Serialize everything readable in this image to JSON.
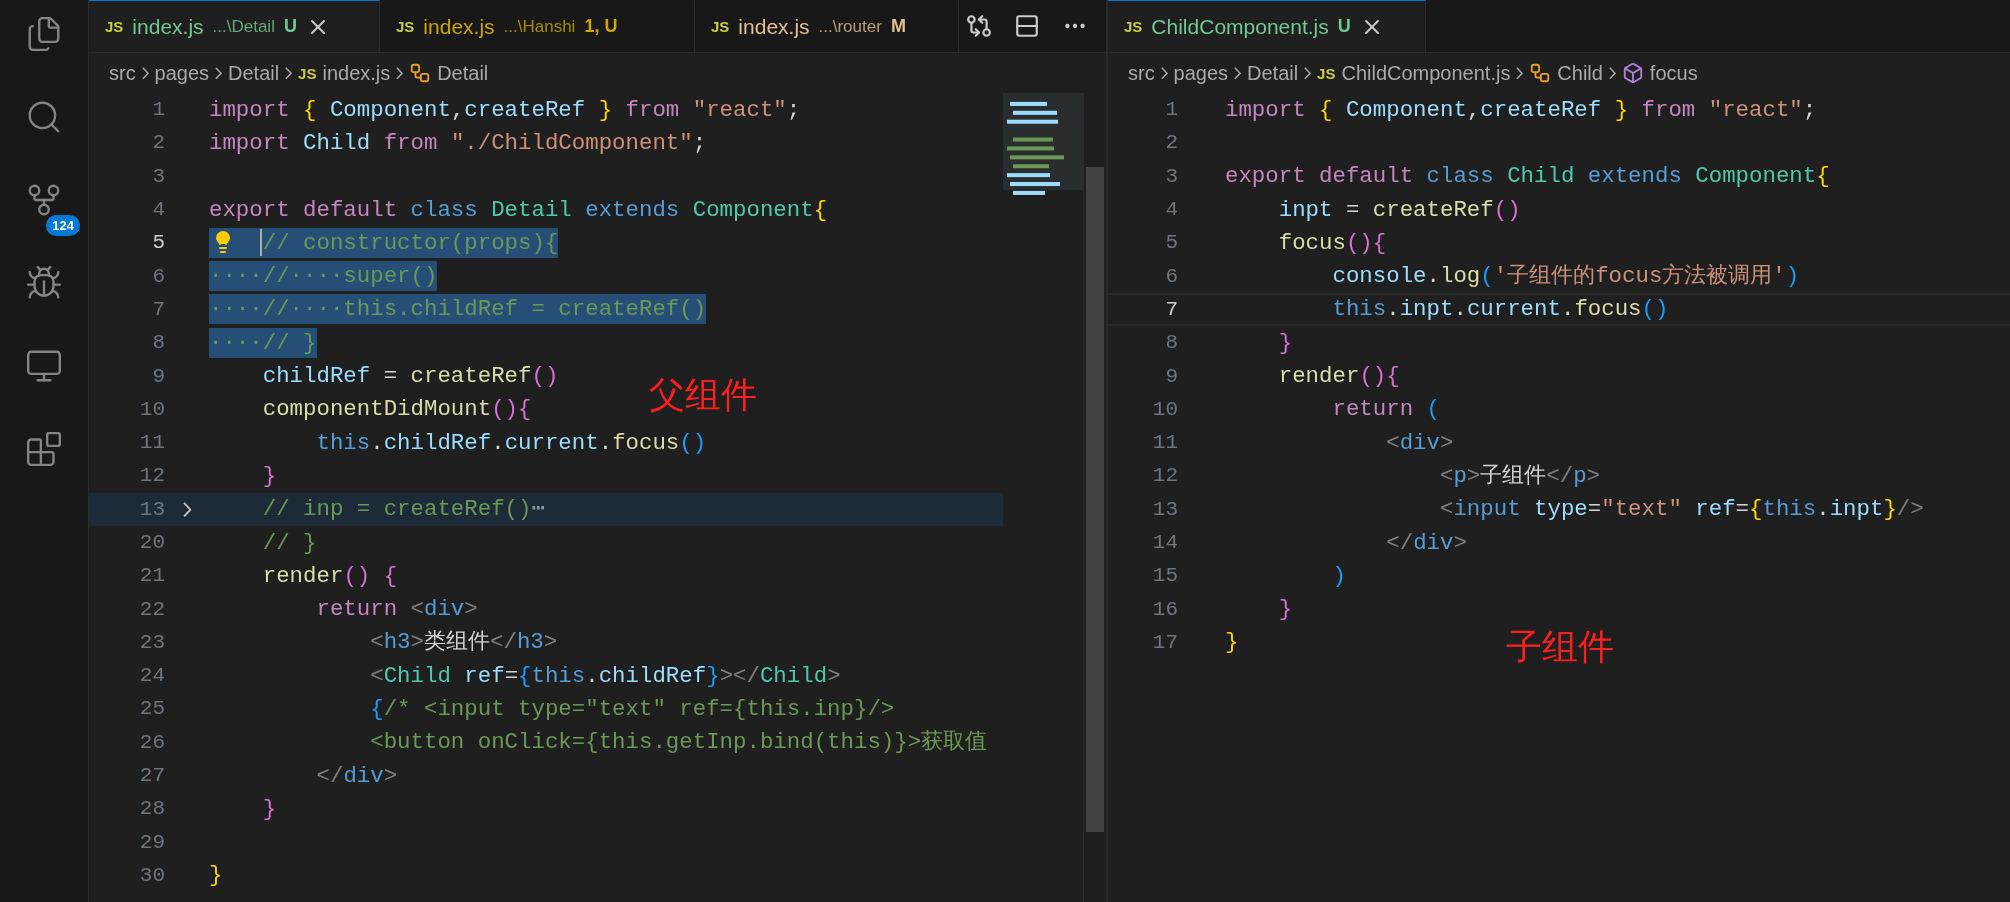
{
  "activity_bar": {
    "source_control_badge": "124"
  },
  "left_editor": {
    "tabs": [
      {
        "icon_text": "JS",
        "name": "index.js",
        "path": "...\\Detail",
        "status": "U",
        "color": "#73c991",
        "selected": true
      },
      {
        "icon_text": "JS",
        "name": "index.js",
        "path": "...\\Hanshi",
        "status": "1, U",
        "color": "#cca700",
        "selected": false
      },
      {
        "icon_text": "JS",
        "name": "index.js",
        "path": "...\\router",
        "status": "M",
        "color": "#e2c08d",
        "selected": false
      }
    ],
    "breadcrumbs": [
      {
        "kind": "folder",
        "text": "src"
      },
      {
        "kind": "folder",
        "text": "pages"
      },
      {
        "kind": "folder",
        "text": "Detail"
      },
      {
        "kind": "file",
        "icon_text": "JS",
        "text": "index.js"
      },
      {
        "kind": "class",
        "text": "Detail"
      }
    ],
    "annotation": "父组件",
    "lines": [
      {
        "number": "1",
        "selected": false,
        "current": false,
        "folded": false,
        "lightbulb": false,
        "tokens": [
          {
            "kind": "kw",
            "text": "import "
          },
          {
            "kind": "b1",
            "text": "{ "
          },
          {
            "kind": "var",
            "text": "Component"
          },
          {
            "kind": "p",
            "text": ","
          },
          {
            "kind": "var",
            "text": "createRef "
          },
          {
            "kind": "b1",
            "text": "} "
          },
          {
            "kind": "kw",
            "text": "from "
          },
          {
            "kind": "str",
            "text": "\"react\""
          },
          {
            "kind": "p",
            "text": ";"
          }
        ]
      },
      {
        "number": "2",
        "selected": false,
        "current": false,
        "folded": false,
        "lightbulb": false,
        "tokens": [
          {
            "kind": "kw",
            "text": "import "
          },
          {
            "kind": "var",
            "text": "Child "
          },
          {
            "kind": "kw",
            "text": "from "
          },
          {
            "kind": "str",
            "text": "\"./ChildComponent\""
          },
          {
            "kind": "p",
            "text": ";"
          }
        ]
      },
      {
        "number": "3",
        "selected": false,
        "current": false,
        "folded": false,
        "lightbulb": false
      },
      {
        "number": "4",
        "selected": false,
        "current": false,
        "folded": false,
        "lightbulb": false,
        "tokens": [
          {
            "kind": "kw",
            "text": "export default "
          },
          {
            "kind": "storage",
            "text": "class "
          },
          {
            "kind": "type",
            "text": "Detail "
          },
          {
            "kind": "storage",
            "text": "extends "
          },
          {
            "kind": "type",
            "text": "Component"
          },
          {
            "kind": "b1",
            "text": "{"
          }
        ]
      },
      {
        "number": "5",
        "selected": true,
        "current": true,
        "folded": false,
        "lightbulb": true,
        "tokens": [
          {
            "kind": "comment",
            "text": "    // constructor(props){"
          }
        ]
      },
      {
        "number": "6",
        "selected": true,
        "current": false,
        "folded": false,
        "lightbulb": false,
        "tokens": [
          {
            "kind": "comment",
            "text": "····//····super()"
          }
        ]
      },
      {
        "number": "7",
        "selected": true,
        "current": false,
        "folded": false,
        "lightbulb": false,
        "tokens": [
          {
            "kind": "comment",
            "text": "····//····this.childRef = createRef()"
          }
        ]
      },
      {
        "number": "8",
        "selected": true,
        "current": false,
        "folded": false,
        "lightbulb": false,
        "tokens": [
          {
            "kind": "comment",
            "text": "····// }"
          }
        ]
      },
      {
        "number": "9",
        "selected": false,
        "current": false,
        "folded": false,
        "lightbulb": false,
        "tokens": [
          {
            "kind": "var",
            "text": "    childRef"
          },
          {
            "kind": "p",
            "text": " = "
          },
          {
            "kind": "fn",
            "text": "createRef"
          },
          {
            "kind": "b2",
            "text": "()"
          }
        ]
      },
      {
        "number": "10",
        "selected": false,
        "current": false,
        "folded": false,
        "lightbulb": false,
        "tokens": [
          {
            "kind": "fn",
            "text": "    componentDidMount"
          },
          {
            "kind": "b2",
            "text": "(){"
          }
        ]
      },
      {
        "number": "11",
        "selected": false,
        "current": false,
        "folded": false,
        "lightbulb": false,
        "tokens": [
          {
            "kind": "storage",
            "text": "        this"
          },
          {
            "kind": "p",
            "text": "."
          },
          {
            "kind": "var",
            "text": "childRef"
          },
          {
            "kind": "p",
            "text": "."
          },
          {
            "kind": "var",
            "text": "current"
          },
          {
            "kind": "p",
            "text": "."
          },
          {
            "kind": "fn",
            "text": "focus"
          },
          {
            "kind": "b3",
            "text": "()"
          }
        ]
      },
      {
        "number": "12",
        "selected": false,
        "current": false,
        "folded": false,
        "lightbulb": false,
        "tokens": [
          {
            "kind": "b2",
            "text": "    }"
          }
        ]
      },
      {
        "number": "13",
        "selected": false,
        "current": false,
        "folded": true,
        "lightbulb": false,
        "tokens": [
          {
            "kind": "comment",
            "text": "    // inp = createRef()"
          },
          {
            "kind": "fold",
            "text": "⋯"
          }
        ]
      },
      {
        "number": "20",
        "selected": false,
        "current": false,
        "folded": false,
        "lightbulb": false,
        "tokens": [
          {
            "kind": "comment",
            "text": "    // }"
          }
        ]
      },
      {
        "number": "21",
        "selected": false,
        "current": false,
        "folded": false,
        "lightbulb": false,
        "tokens": [
          {
            "kind": "fn",
            "text": "    render"
          },
          {
            "kind": "b2",
            "text": "() {"
          }
        ]
      },
      {
        "number": "22",
        "selected": false,
        "current": false,
        "folded": false,
        "lightbulb": false,
        "tokens": [
          {
            "kind": "kw",
            "text": "        return "
          },
          {
            "kind": "tag",
            "text": "<"
          },
          {
            "kind": "tagname",
            "text": "div"
          },
          {
            "kind": "tag",
            "text": ">"
          }
        ]
      },
      {
        "number": "23",
        "selected": false,
        "current": false,
        "folded": false,
        "lightbulb": false,
        "tokens": [
          {
            "kind": "tag",
            "text": "            <"
          },
          {
            "kind": "tagname",
            "text": "h3"
          },
          {
            "kind": "tag",
            "text": ">"
          },
          {
            "kind": "p",
            "text": "类组件"
          },
          {
            "kind": "tag",
            "text": "</"
          },
          {
            "kind": "tagname",
            "text": "h3"
          },
          {
            "kind": "tag",
            "text": ">"
          }
        ]
      },
      {
        "number": "24",
        "selected": false,
        "current": false,
        "folded": false,
        "lightbulb": false,
        "tokens": [
          {
            "kind": "tag",
            "text": "            <"
          },
          {
            "kind": "type",
            "text": "Child "
          },
          {
            "kind": "var",
            "text": "ref"
          },
          {
            "kind": "p",
            "text": "="
          },
          {
            "kind": "b3",
            "text": "{"
          },
          {
            "kind": "storage",
            "text": "this"
          },
          {
            "kind": "p",
            "text": "."
          },
          {
            "kind": "var",
            "text": "childRef"
          },
          {
            "kind": "b3",
            "text": "}"
          },
          {
            "kind": "tag",
            "text": "></"
          },
          {
            "kind": "type",
            "text": "Child"
          },
          {
            "kind": "tag",
            "text": ">"
          }
        ]
      },
      {
        "number": "25",
        "selected": false,
        "current": false,
        "folded": false,
        "lightbulb": false,
        "tokens": [
          {
            "kind": "b3",
            "text": "            {"
          },
          {
            "kind": "comment",
            "text": "/* <input type=\"text\" ref={this.inp}/>"
          }
        ]
      },
      {
        "number": "26",
        "selected": false,
        "current": false,
        "folded": false,
        "lightbulb": false,
        "tokens": [
          {
            "kind": "comment",
            "text": "            <button onClick={this.getInp.bind(this)}>获取值"
          }
        ]
      },
      {
        "number": "27",
        "selected": false,
        "current": false,
        "folded": false,
        "lightbulb": false,
        "tokens": [
          {
            "kind": "tag",
            "text": "        </"
          },
          {
            "kind": "tagname",
            "text": "div"
          },
          {
            "kind": "tag",
            "text": ">"
          }
        ]
      },
      {
        "number": "28",
        "selected": false,
        "current": false,
        "folded": false,
        "lightbulb": false,
        "tokens": [
          {
            "kind": "b2",
            "text": "    }"
          }
        ]
      },
      {
        "number": "29",
        "selected": false,
        "current": false,
        "folded": false,
        "lightbulb": false
      },
      {
        "number": "30",
        "selected": false,
        "current": false,
        "folded": false,
        "lightbulb": false,
        "tokens": [
          {
            "kind": "b1",
            "text": "}"
          }
        ]
      }
    ]
  },
  "right_editor": {
    "tabs": [
      {
        "icon_text": "JS",
        "name": "ChildComponent.js",
        "status": "U",
        "color": "#73c991",
        "selected": true
      }
    ],
    "breadcrumbs": [
      {
        "kind": "folder",
        "text": "src"
      },
      {
        "kind": "folder",
        "text": "pages"
      },
      {
        "kind": "folder",
        "text": "Detail"
      },
      {
        "kind": "file",
        "icon_text": "JS",
        "text": "ChildComponent.js"
      },
      {
        "kind": "class",
        "text": "Child"
      },
      {
        "kind": "method",
        "text": "focus"
      }
    ],
    "annotation": "子组件",
    "lines": [
      {
        "number": "1",
        "current": false,
        "tokens": [
          {
            "kind": "kw",
            "text": "import "
          },
          {
            "kind": "b1",
            "text": "{ "
          },
          {
            "kind": "var",
            "text": "Component"
          },
          {
            "kind": "p",
            "text": ","
          },
          {
            "kind": "var",
            "text": "createRef "
          },
          {
            "kind": "b1",
            "text": "} "
          },
          {
            "kind": "kw",
            "text": "from "
          },
          {
            "kind": "str",
            "text": "\"react\""
          },
          {
            "kind": "p",
            "text": ";"
          }
        ]
      },
      {
        "number": "2",
        "current": false
      },
      {
        "number": "3",
        "current": false,
        "tokens": [
          {
            "kind": "kw",
            "text": "export default "
          },
          {
            "kind": "storage",
            "text": "class "
          },
          {
            "kind": "type",
            "text": "Child "
          },
          {
            "kind": "storage",
            "text": "extends "
          },
          {
            "kind": "type",
            "text": "Component"
          },
          {
            "kind": "b1",
            "text": "{"
          }
        ]
      },
      {
        "number": "4",
        "current": false,
        "tokens": [
          {
            "kind": "var",
            "text": "    inpt"
          },
          {
            "kind": "p",
            "text": " = "
          },
          {
            "kind": "fn",
            "text": "createRef"
          },
          {
            "kind": "b2",
            "text": "()"
          }
        ]
      },
      {
        "number": "5",
        "current": false,
        "tokens": [
          {
            "kind": "fn",
            "text": "    focus"
          },
          {
            "kind": "b2",
            "text": "(){"
          }
        ]
      },
      {
        "number": "6",
        "current": false,
        "tokens": [
          {
            "kind": "var",
            "text": "        console"
          },
          {
            "kind": "p",
            "text": "."
          },
          {
            "kind": "fn",
            "text": "log"
          },
          {
            "kind": "b3",
            "text": "("
          },
          {
            "kind": "str",
            "text": "'子组件的focus方法被调用'"
          },
          {
            "kind": "b3",
            "text": ")"
          }
        ]
      },
      {
        "number": "7",
        "current": true,
        "tokens": [
          {
            "kind": "storage",
            "text": "        this"
          },
          {
            "kind": "p",
            "text": "."
          },
          {
            "kind": "var",
            "text": "inpt"
          },
          {
            "kind": "p",
            "text": "."
          },
          {
            "kind": "var",
            "text": "current"
          },
          {
            "kind": "p",
            "text": "."
          },
          {
            "kind": "fn",
            "text": "focus"
          },
          {
            "kind": "b3",
            "text": "()"
          }
        ]
      },
      {
        "number": "8",
        "current": false,
        "tokens": [
          {
            "kind": "b2",
            "text": "    }"
          }
        ]
      },
      {
        "number": "9",
        "current": false,
        "tokens": [
          {
            "kind": "fn",
            "text": "    render"
          },
          {
            "kind": "b2",
            "text": "(){"
          }
        ]
      },
      {
        "number": "10",
        "current": false,
        "tokens": [
          {
            "kind": "kw",
            "text": "        return "
          },
          {
            "kind": "b3",
            "text": "("
          }
        ]
      },
      {
        "number": "11",
        "current": false,
        "tokens": [
          {
            "kind": "tag",
            "text": "            <"
          },
          {
            "kind": "tagname",
            "text": "div"
          },
          {
            "kind": "tag",
            "text": ">"
          }
        ]
      },
      {
        "number": "12",
        "current": false,
        "tokens": [
          {
            "kind": "tag",
            "text": "                <"
          },
          {
            "kind": "tagname",
            "text": "p"
          },
          {
            "kind": "tag",
            "text": ">"
          },
          {
            "kind": "p",
            "text": "子组件"
          },
          {
            "kind": "tag",
            "text": "</"
          },
          {
            "kind": "tagname",
            "text": "p"
          },
          {
            "kind": "tag",
            "text": ">"
          }
        ]
      },
      {
        "number": "13",
        "current": false,
        "tokens": [
          {
            "kind": "tag",
            "text": "                <"
          },
          {
            "kind": "tagname",
            "text": "input "
          },
          {
            "kind": "var",
            "text": "type"
          },
          {
            "kind": "p",
            "text": "="
          },
          {
            "kind": "str",
            "text": "\"text\" "
          },
          {
            "kind": "var",
            "text": "ref"
          },
          {
            "kind": "p",
            "text": "="
          },
          {
            "kind": "b1",
            "text": "{"
          },
          {
            "kind": "storage",
            "text": "this"
          },
          {
            "kind": "p",
            "text": "."
          },
          {
            "kind": "var",
            "text": "inpt"
          },
          {
            "kind": "b1",
            "text": "}"
          },
          {
            "kind": "tag",
            "text": "/>"
          }
        ]
      },
      {
        "number": "14",
        "current": false,
        "tokens": [
          {
            "kind": "tag",
            "text": "            </"
          },
          {
            "kind": "tagname",
            "text": "div"
          },
          {
            "kind": "tag",
            "text": ">"
          }
        ]
      },
      {
        "number": "15",
        "current": false,
        "tokens": [
          {
            "kind": "b3",
            "text": "        )"
          }
        ]
      },
      {
        "number": "16",
        "current": false,
        "tokens": [
          {
            "kind": "b2",
            "text": "    }"
          }
        ]
      },
      {
        "number": "17",
        "current": false,
        "tokens": [
          {
            "kind": "b1",
            "text": "}"
          }
        ]
      }
    ]
  }
}
